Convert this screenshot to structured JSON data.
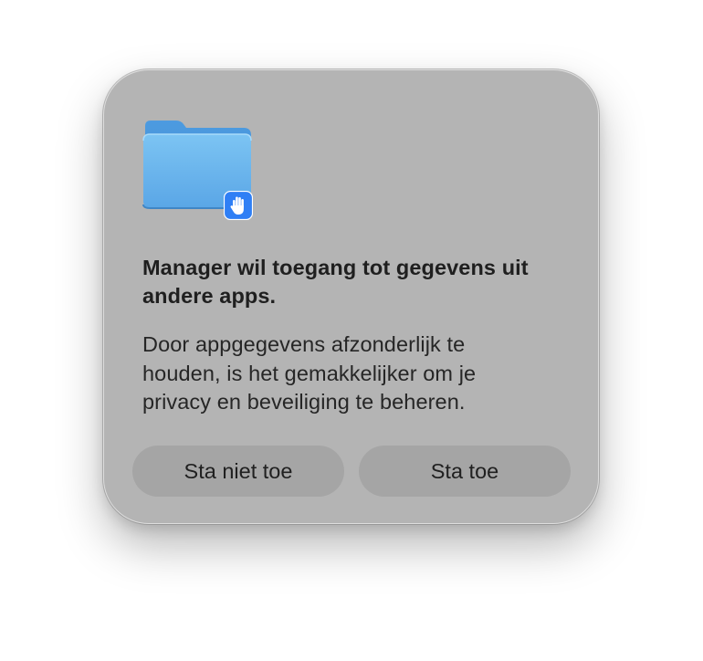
{
  "dialog": {
    "icon": "folder-icon",
    "badge_icon": "raised-hand-icon",
    "title": "Manager wil toegang tot gegevens uit andere apps.",
    "message": "Door appgegevens afzonderlijk te houden, is het gemakkelijker om je privacy en beveiliging te beheren.",
    "buttons": {
      "deny_label": "Sta niet toe",
      "allow_label": "Sta toe"
    }
  },
  "colors": {
    "panel": "#b4b4b4",
    "button": "#a5a5a5",
    "folder_blue": "#6eb7ee",
    "badge_blue": "#2f7ff5"
  }
}
